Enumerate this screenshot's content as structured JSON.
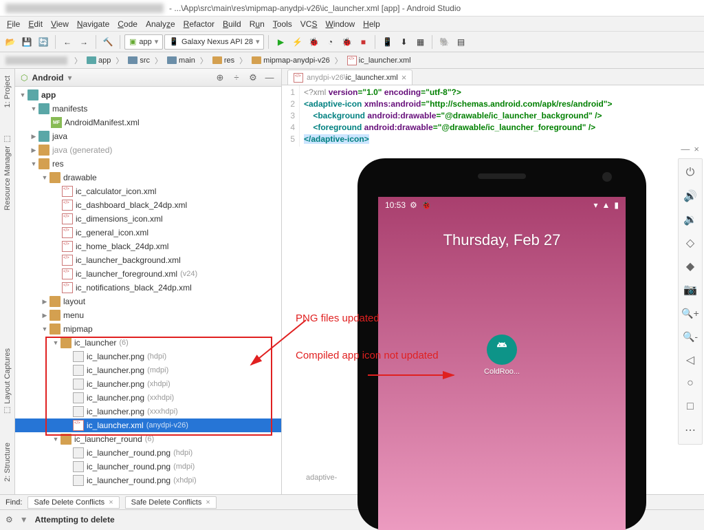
{
  "window": {
    "title": "- ...\\App\\src\\main\\res\\mipmap-anydpi-v26\\ic_launcher.xml [app] - Android Studio"
  },
  "menu": [
    "File",
    "Edit",
    "View",
    "Navigate",
    "Code",
    "Analyze",
    "Refactor",
    "Build",
    "Run",
    "Tools",
    "VCS",
    "Window",
    "Help"
  ],
  "toolbar": {
    "config": "app",
    "device": "Galaxy Nexus API 28"
  },
  "breadcrumb": [
    "app",
    "src",
    "main",
    "res",
    "mipmap-anydpi-v26",
    "ic_launcher.xml"
  ],
  "panel": {
    "mode": "Android"
  },
  "tree": {
    "app": "app",
    "manifests": "manifests",
    "manifest_file": "AndroidManifest.xml",
    "java": "java",
    "java_gen": "java (generated)",
    "res": "res",
    "drawable": "drawable",
    "drawables": [
      "ic_calculator_icon.xml",
      "ic_dashboard_black_24dp.xml",
      "ic_dimensions_icon.xml",
      "ic_general_icon.xml",
      "ic_home_black_24dp.xml",
      "ic_launcher_background.xml",
      "ic_launcher_foreground.xml",
      "ic_notifications_black_24dp.xml"
    ],
    "drawable_qual": "(v24)",
    "layout": "layout",
    "menu": "menu",
    "mipmap": "mipmap",
    "ic_launcher": "ic_launcher",
    "ic_launcher_count": "(6)",
    "launcher_files": [
      {
        "n": "ic_launcher.png",
        "q": "(hdpi)"
      },
      {
        "n": "ic_launcher.png",
        "q": "(mdpi)"
      },
      {
        "n": "ic_launcher.png",
        "q": "(xhdpi)"
      },
      {
        "n": "ic_launcher.png",
        "q": "(xxhdpi)"
      },
      {
        "n": "ic_launcher.png",
        "q": "(xxxhdpi)"
      },
      {
        "n": "ic_launcher.xml",
        "q": "(anydpi-v26)"
      }
    ],
    "ic_launcher_round": "ic_launcher_round",
    "round_count": "(6)",
    "round_files": [
      {
        "n": "ic_launcher_round.png",
        "q": "(hdpi)"
      },
      {
        "n": "ic_launcher_round.png",
        "q": "(mdpi)"
      },
      {
        "n": "ic_launcher_round.png",
        "q": "(xhdpi)"
      }
    ]
  },
  "editor": {
    "tab_prefix": "anydpi-v26\\",
    "tab_file": "ic_launcher.xml",
    "lines": [
      "1",
      "2",
      "3",
      "4",
      "5"
    ],
    "l1a": "<?xml ",
    "l1b": "version",
    "l1c": "=\"1.0\" ",
    "l1d": "encoding",
    "l1e": "=\"utf-8\"?>",
    "l2a": "<adaptive-icon ",
    "l2b": "xmlns:android",
    "l2c": "=\"http://schemas.android.com/apk/res/android\">",
    "l3a": "    <background ",
    "l3b": "android:drawable",
    "l3c": "=\"@drawable/ic_launcher_background\" />",
    "l4a": "    <foreground ",
    "l4b": "android:drawable",
    "l4c": "=\"@drawable/ic_launcher_foreground\" />",
    "l5": "</adaptive-icon>"
  },
  "emulator": {
    "time": "10:53",
    "date": "Thursday, Feb 27",
    "app_name": "ColdRoo..."
  },
  "annotations": {
    "a1": "PNG files updated",
    "a2": "Compiled app icon not updated"
  },
  "bottom": {
    "find": "Find:",
    "tab1": "Safe Delete Conflicts",
    "tab2": "Safe Delete Conflicts",
    "attempting": "Attempting to delete"
  },
  "adaptive_crumb": "adaptive-"
}
